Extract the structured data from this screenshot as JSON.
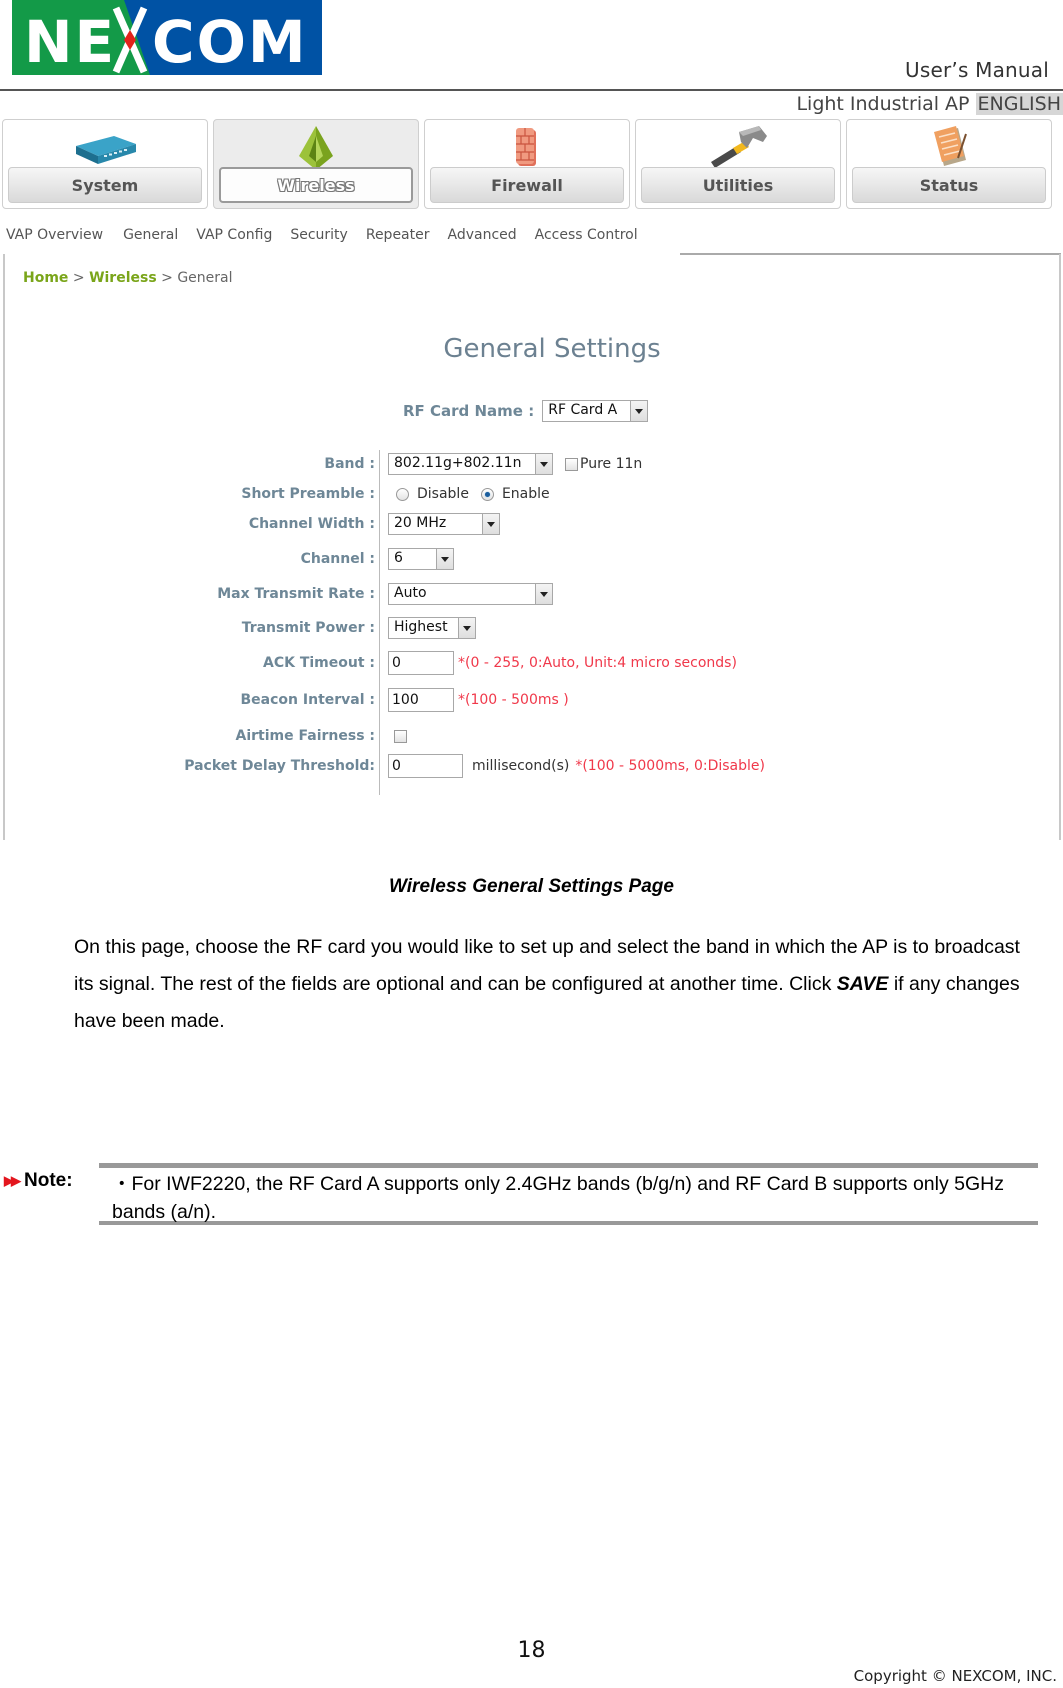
{
  "header": {
    "logo_text": "NEXCOM",
    "doc_type": "User’s Manual",
    "product": "Light Industrial AP",
    "language": "ENGLISH",
    "colors": {
      "logo_green": "#139a48",
      "logo_blue": "#0052a4",
      "logo_accent": "#e2231a"
    }
  },
  "topnav": {
    "items": [
      {
        "label": "System",
        "icon": "router-icon",
        "active": false
      },
      {
        "label": "Wireless",
        "icon": "pyramid-antenna-icon",
        "active": true
      },
      {
        "label": "Firewall",
        "icon": "brick-wall-icon",
        "active": false
      },
      {
        "label": "Utilities",
        "icon": "hammer-icon",
        "active": false
      },
      {
        "label": "Status",
        "icon": "notepad-icon",
        "active": false
      }
    ]
  },
  "subtabs": {
    "items": [
      {
        "label": "VAP Overview",
        "active": false
      },
      {
        "label": "General",
        "active": true
      },
      {
        "label": "VAP Config",
        "active": false
      },
      {
        "label": "Security",
        "active": false
      },
      {
        "label": "Repeater",
        "active": false
      },
      {
        "label": "Advanced",
        "active": false
      },
      {
        "label": "Access Control",
        "active": false
      }
    ]
  },
  "breadcrumb": {
    "home": "Home",
    "sep1": " > ",
    "section": "Wireless",
    "sep2": " > ",
    "current": "General"
  },
  "settings": {
    "title": "General Settings",
    "rf_card": {
      "label": "RF Card Name :",
      "value": "RF Card A"
    },
    "band": {
      "label": "Band :",
      "value": "802.11g+802.11n",
      "pure11n_label": "Pure 11n",
      "pure11n_checked": false
    },
    "short_preamble": {
      "label": "Short Preamble :",
      "options": [
        "Disable",
        "Enable"
      ],
      "selected": "Enable"
    },
    "channel_width": {
      "label": "Channel Width :",
      "value": "20 MHz"
    },
    "channel": {
      "label": "Channel :",
      "value": "6"
    },
    "max_tx_rate": {
      "label": "Max Transmit Rate :",
      "value": "Auto"
    },
    "tx_power": {
      "label": "Transmit Power :",
      "value": "Highest"
    },
    "ack_timeout": {
      "label": "ACK Timeout :",
      "value": "0",
      "hint": "*(0 - 255, 0:Auto, Unit:4 micro seconds)"
    },
    "beacon_interval": {
      "label": "Beacon Interval :",
      "value": "100",
      "hint": "*(100 - 500ms )"
    },
    "airtime_fairness": {
      "label": "Airtime Fairness :",
      "checked": false
    },
    "packet_delay": {
      "label": "Packet Delay Threshold:",
      "value": "0",
      "unit": "millisecond(s)",
      "hint": "*(100 - 5000ms, 0:Disable)"
    }
  },
  "document": {
    "caption": "Wireless General Settings Page",
    "para_part1": "On this page, choose the RF card you would like to set up and select the band in which the AP is to broadcast its signal.  The rest of the fields are optional and can be configured at another time. Click ",
    "para_bold": "SAVE",
    "para_part2": " if any changes have been made.",
    "note_label": "Note:",
    "note_text": "・For IWF2220, the RF Card A supports only 2.4GHz bands (b/g/n) and RF Card B supports only 5GHz bands (a/n)."
  },
  "footer": {
    "page_number": "18",
    "copyright": "Copyright © NEXCOM, INC."
  }
}
